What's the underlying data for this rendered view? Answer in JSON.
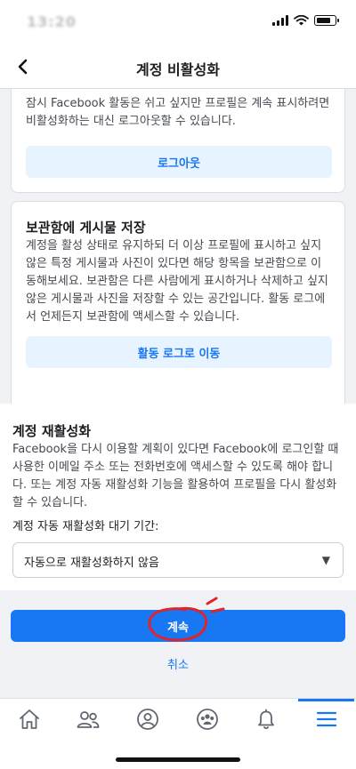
{
  "status_bar": {
    "time": "13:20"
  },
  "header": {
    "title": "계정 비활성화"
  },
  "logout_card": {
    "text": "잠시 Facebook 활동은 쉬고 싶지만 프로필은 계속 표시하려면 비활성화하는 대신 로그아웃할 수 있습니다.",
    "button_label": "로그아웃"
  },
  "archive_card": {
    "title": "보관함에 게시물 저장",
    "text": "계정을 활성 상태로 유지하되 더 이상 프로필에 표시하고 싶지 않은 특정 게시물과 사진이 있다면 해당 항목을 보관함으로 이동해보세요. 보관함은 다른 사람에게 표시하거나 삭제하고 싶지 않은 게시물과 사진을 저장할 수 있는 공간입니다. 활동 로그에서 언제든지 보관함에 액세스할 수 있습니다.",
    "button_label": "활동 로그로 이동"
  },
  "reactivation": {
    "title": "계정 재활성화",
    "text": "Facebook을 다시 이용할 계획이 있다면 Facebook에 로그인할 때 사용한 이메일 주소 또는 전화번호에 액세스할 수 있도록 해야 합니다. 또는 계정 자동 재활성화 기능을 활용하여 프로필을 다시 활성화할 수 있습니다.",
    "select_label": "계정 자동 재활성화 대기 기간:",
    "select_value": "자동으로 재활성화하지 않음"
  },
  "actions": {
    "continue_label": "계속",
    "cancel_label": "취소"
  },
  "tab_bar": {
    "tabs": [
      "home-icon",
      "friends-icon",
      "profile-icon",
      "groups-icon",
      "notifications-icon",
      "menu-icon"
    ],
    "active_tab": "menu-icon"
  },
  "colors": {
    "accent": "#1877f2",
    "accent_light": "#e7f3ff",
    "annotation": "#e0242b"
  }
}
